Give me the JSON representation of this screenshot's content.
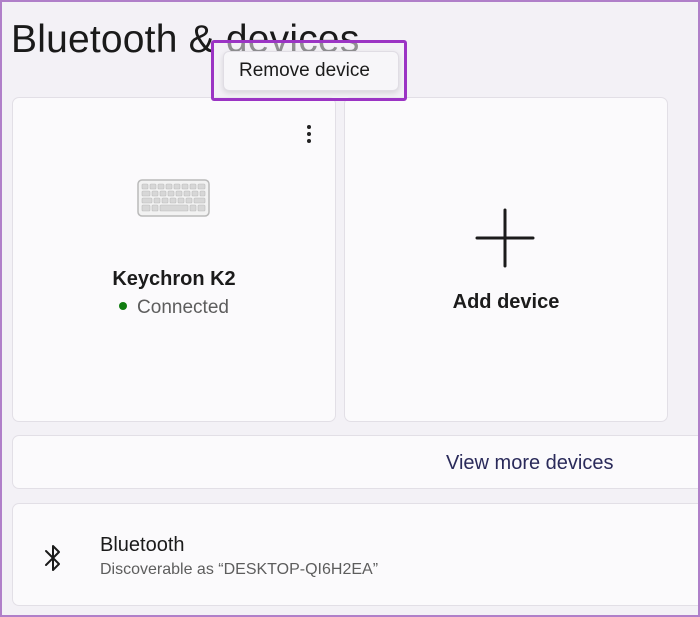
{
  "header": {
    "title": "Bluetooth & devices"
  },
  "context_menu": {
    "items": [
      {
        "label": "Remove device"
      }
    ]
  },
  "devices": [
    {
      "name": "Keychron K2",
      "status": "Connected",
      "status_color": "#107c10",
      "icon": "keyboard-icon"
    }
  ],
  "add_device": {
    "label": "Add device",
    "icon": "plus-icon"
  },
  "view_more": {
    "label": "View more devices"
  },
  "bluetooth": {
    "title": "Bluetooth",
    "subtitle": "Discoverable as “DESKTOP-QI6H2EA”",
    "icon": "bluetooth-icon"
  },
  "colors": {
    "highlight": "#9b34c4",
    "connected": "#107c10",
    "background": "#f3f1f6"
  }
}
